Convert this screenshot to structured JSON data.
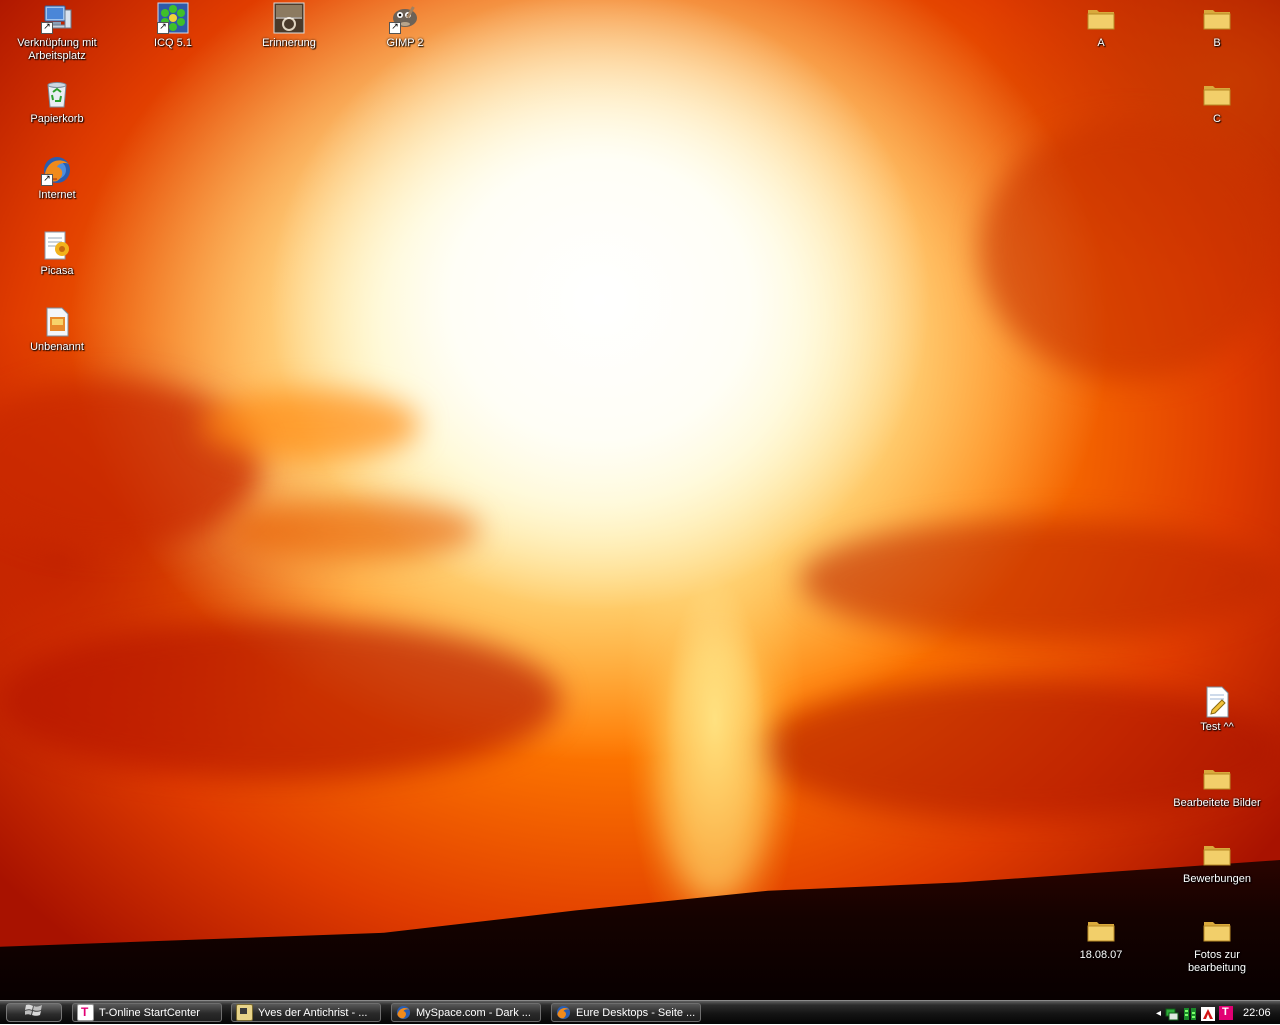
{
  "desktop": {
    "icons_left": [
      {
        "label": "Verknüpfung mit Arbeitsplatz",
        "icon": "my-computer-icon"
      },
      {
        "label": "ICQ 5.1",
        "icon": "icq-flower-icon"
      },
      {
        "label": "Erinnerung",
        "icon": "video-file-icon"
      },
      {
        "label": "GIMP 2",
        "icon": "gimp-icon"
      },
      {
        "label": "Papierkorb",
        "icon": "recycle-bin-icon"
      },
      {
        "label": "Internet",
        "icon": "firefox-icon"
      },
      {
        "label": "Picasa",
        "icon": "picasa-icon"
      },
      {
        "label": "Unbenannt",
        "icon": "image-file-icon"
      }
    ],
    "icons_right": [
      {
        "label": "A",
        "icon": "folder-icon"
      },
      {
        "label": "B",
        "icon": "folder-icon"
      },
      {
        "label": "C",
        "icon": "folder-icon"
      },
      {
        "label": "Test ^^",
        "icon": "document-icon"
      },
      {
        "label": "Bearbeitete Bilder",
        "icon": "folder-icon"
      },
      {
        "label": "Bewerbungen",
        "icon": "folder-icon"
      },
      {
        "label": "18.08.07",
        "icon": "folder-icon"
      },
      {
        "label": "Fotos zur bearbeitung",
        "icon": "folder-icon"
      }
    ]
  },
  "taskbar": {
    "start_icon": "windows-logo-icon",
    "tasks": [
      {
        "label": "T-Online StartCenter",
        "icon": "t-online-icon"
      },
      {
        "label": "Yves der Antichrist - ...",
        "icon": "messenger-icon"
      },
      {
        "label": "MySpace.com - Dark ...",
        "icon": "firefox-icon"
      },
      {
        "label": "Eure Desktops - Seite ...",
        "icon": "firefox-icon"
      }
    ],
    "tray": {
      "expand": "◂",
      "clock": "22:06"
    }
  },
  "colors": {
    "folder": "#e8c55a",
    "taskbar": "#141414",
    "tonline_magenta": "#e20074"
  }
}
